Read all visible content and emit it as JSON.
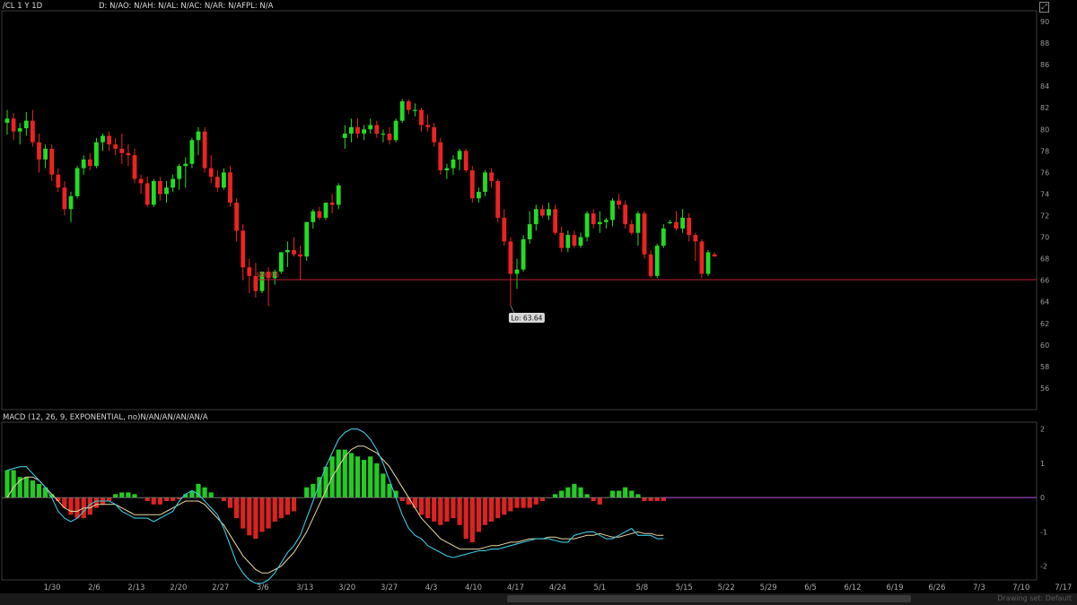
{
  "header": {
    "symbol_label": "/CL 1 Y 1D",
    "ohlc_label": "D: N/AO: N/AH: N/AL: N/AC: N/AR: N/AFPL: N/A"
  },
  "macd_header": {
    "label": "MACD (12, 26, 9, EXPONENTIAL, no)N/AN/AN/AN/AN/A"
  },
  "toolbar": {
    "drawing_set_label": "Drawing set: Default"
  },
  "colors": {
    "up": "#22dd22",
    "down": "#ee2222",
    "support_line": "#c0203a",
    "macd": "#3cc8e0",
    "signal": "#e8d8a0",
    "hist_up": "#22cc22",
    "hist_down": "#dd2222",
    "zero_line": "#aa44cc"
  },
  "chart_data": [
    {
      "type": "candlestick",
      "title": "/CL 1 Y 1D",
      "ylim": [
        54,
        91
      ],
      "y_ticks": [
        56,
        58,
        60,
        62,
        64,
        66,
        68,
        70,
        72,
        74,
        76,
        78,
        80,
        82,
        84,
        86,
        88,
        90
      ],
      "x_ticks": [
        "1/30",
        "2/6",
        "2/13",
        "2/20",
        "2/27",
        "3/6",
        "3/13",
        "3/20",
        "3/27",
        "4/3",
        "4/10",
        "4/17",
        "4/24",
        "5/1",
        "5/8",
        "5/15",
        "5/22",
        "5/29",
        "6/5",
        "6/12",
        "6/19",
        "6/26",
        "7/3",
        "7/10",
        "7/17"
      ],
      "support_level": {
        "value": 66.06,
        "label": "$66.06"
      },
      "low_annotation": {
        "value": 63.64,
        "label": "Lo: 63.64"
      },
      "candles": [
        {
          "o": 80.6,
          "h": 81.8,
          "l": 79.5,
          "c": 81.0
        },
        {
          "o": 81.0,
          "h": 81.5,
          "l": 79.0,
          "c": 79.8
        },
        {
          "o": 79.8,
          "h": 80.6,
          "l": 78.6,
          "c": 80.1
        },
        {
          "o": 80.1,
          "h": 81.6,
          "l": 79.4,
          "c": 80.8
        },
        {
          "o": 80.8,
          "h": 81.8,
          "l": 78.4,
          "c": 78.8
        },
        {
          "o": 78.8,
          "h": 79.6,
          "l": 76.0,
          "c": 77.2
        },
        {
          "o": 77.2,
          "h": 78.6,
          "l": 76.4,
          "c": 78.2
        },
        {
          "o": 78.2,
          "h": 78.6,
          "l": 75.2,
          "c": 75.8
        },
        {
          "o": 75.8,
          "h": 76.4,
          "l": 74.2,
          "c": 74.6
        },
        {
          "o": 74.6,
          "h": 75.2,
          "l": 72.0,
          "c": 72.6
        },
        {
          "o": 72.6,
          "h": 74.2,
          "l": 71.4,
          "c": 73.8
        },
        {
          "o": 73.8,
          "h": 76.6,
          "l": 73.6,
          "c": 76.4
        },
        {
          "o": 76.4,
          "h": 77.6,
          "l": 75.8,
          "c": 77.2
        },
        {
          "o": 77.2,
          "h": 77.8,
          "l": 76.2,
          "c": 76.6
        },
        {
          "o": 76.6,
          "h": 79.2,
          "l": 76.4,
          "c": 78.8
        },
        {
          "o": 78.8,
          "h": 79.6,
          "l": 78.0,
          "c": 79.4
        },
        {
          "o": 79.4,
          "h": 79.8,
          "l": 78.0,
          "c": 78.6
        },
        {
          "o": 78.6,
          "h": 79.2,
          "l": 77.6,
          "c": 78.2
        },
        {
          "o": 78.2,
          "h": 79.6,
          "l": 76.8,
          "c": 77.8
        },
        {
          "o": 77.8,
          "h": 78.6,
          "l": 76.6,
          "c": 77.6
        },
        {
          "o": 77.6,
          "h": 78.2,
          "l": 75.0,
          "c": 75.4
        },
        {
          "o": 75.4,
          "h": 75.8,
          "l": 74.0,
          "c": 75.0
        },
        {
          "o": 75.0,
          "h": 75.6,
          "l": 72.8,
          "c": 73.0
        },
        {
          "o": 73.0,
          "h": 75.4,
          "l": 72.8,
          "c": 75.2
        },
        {
          "o": 75.2,
          "h": 75.6,
          "l": 73.4,
          "c": 74.0
        },
        {
          "o": 74.0,
          "h": 75.2,
          "l": 73.2,
          "c": 74.6
        },
        {
          "o": 74.6,
          "h": 75.8,
          "l": 74.2,
          "c": 75.4
        },
        {
          "o": 75.4,
          "h": 76.8,
          "l": 74.4,
          "c": 76.6
        },
        {
          "o": 76.6,
          "h": 77.4,
          "l": 74.6,
          "c": 76.8
        },
        {
          "o": 76.8,
          "h": 79.2,
          "l": 76.4,
          "c": 79.0
        },
        {
          "o": 79.0,
          "h": 80.2,
          "l": 77.6,
          "c": 79.8
        },
        {
          "o": 79.8,
          "h": 80.2,
          "l": 76.0,
          "c": 76.4
        },
        {
          "o": 76.4,
          "h": 77.6,
          "l": 75.0,
          "c": 75.6
        },
        {
          "o": 75.6,
          "h": 76.2,
          "l": 74.2,
          "c": 74.6
        },
        {
          "o": 74.6,
          "h": 76.4,
          "l": 74.4,
          "c": 76.0
        },
        {
          "o": 76.0,
          "h": 76.6,
          "l": 72.8,
          "c": 73.2
        },
        {
          "o": 73.2,
          "h": 73.6,
          "l": 69.6,
          "c": 70.6
        },
        {
          "o": 70.6,
          "h": 71.2,
          "l": 66.0,
          "c": 67.2
        },
        {
          "o": 67.2,
          "h": 68.0,
          "l": 64.8,
          "c": 66.4
        },
        {
          "o": 66.4,
          "h": 67.6,
          "l": 64.4,
          "c": 65.0
        },
        {
          "o": 65.0,
          "h": 66.4,
          "l": 64.8,
          "c": 66.8
        },
        {
          "o": 66.8,
          "h": 67.2,
          "l": 63.6,
          "c": 66.2
        },
        {
          "o": 66.2,
          "h": 67.0,
          "l": 65.6,
          "c": 66.8
        },
        {
          "o": 66.8,
          "h": 68.4,
          "l": 66.6,
          "c": 68.6
        },
        {
          "o": 68.6,
          "h": 69.6,
          "l": 67.2,
          "c": 68.8
        },
        {
          "o": 68.8,
          "h": 70.0,
          "l": 68.2,
          "c": 68.4
        },
        {
          "o": 68.4,
          "h": 69.2,
          "l": 66.0,
          "c": 68.2
        },
        {
          "o": 68.2,
          "h": 71.4,
          "l": 67.8,
          "c": 71.4
        },
        {
          "o": 71.4,
          "h": 72.6,
          "l": 70.8,
          "c": 72.4
        },
        {
          "o": 72.4,
          "h": 72.8,
          "l": 71.6,
          "c": 71.8
        },
        {
          "o": 71.8,
          "h": 73.0,
          "l": 71.6,
          "c": 73.2
        },
        {
          "o": 73.2,
          "h": 74.0,
          "l": 72.2,
          "c": 73.0
        },
        {
          "o": 73.0,
          "h": 75.0,
          "l": 72.6,
          "c": 74.8
        },
        {
          "o": 79.2,
          "h": 80.4,
          "l": 78.2,
          "c": 79.6
        },
        {
          "o": 79.6,
          "h": 81.0,
          "l": 78.8,
          "c": 80.2
        },
        {
          "o": 80.2,
          "h": 81.0,
          "l": 79.2,
          "c": 79.6
        },
        {
          "o": 79.6,
          "h": 80.4,
          "l": 79.0,
          "c": 80.0
        },
        {
          "o": 80.0,
          "h": 81.0,
          "l": 79.6,
          "c": 80.4
        },
        {
          "o": 80.4,
          "h": 80.8,
          "l": 79.2,
          "c": 79.6
        },
        {
          "o": 79.6,
          "h": 80.0,
          "l": 78.8,
          "c": 79.6
        },
        {
          "o": 79.6,
          "h": 80.2,
          "l": 78.6,
          "c": 79.0
        },
        {
          "o": 79.0,
          "h": 81.0,
          "l": 78.8,
          "c": 80.8
        },
        {
          "o": 80.8,
          "h": 82.8,
          "l": 80.6,
          "c": 82.6
        },
        {
          "o": 82.6,
          "h": 82.8,
          "l": 81.4,
          "c": 81.8
        },
        {
          "o": 81.8,
          "h": 82.4,
          "l": 81.2,
          "c": 81.8
        },
        {
          "o": 81.8,
          "h": 82.0,
          "l": 79.8,
          "c": 80.4
        },
        {
          "o": 80.4,
          "h": 81.4,
          "l": 79.8,
          "c": 80.2
        },
        {
          "o": 80.2,
          "h": 80.6,
          "l": 78.4,
          "c": 78.8
        },
        {
          "o": 78.8,
          "h": 79.2,
          "l": 75.8,
          "c": 76.2
        },
        {
          "o": 76.2,
          "h": 76.8,
          "l": 75.4,
          "c": 76.4
        },
        {
          "o": 76.4,
          "h": 77.6,
          "l": 75.8,
          "c": 77.2
        },
        {
          "o": 77.2,
          "h": 78.2,
          "l": 76.2,
          "c": 78.0
        },
        {
          "o": 78.0,
          "h": 78.2,
          "l": 76.0,
          "c": 76.2
        },
        {
          "o": 76.2,
          "h": 76.6,
          "l": 73.2,
          "c": 73.6
        },
        {
          "o": 73.6,
          "h": 74.6,
          "l": 73.2,
          "c": 74.2
        },
        {
          "o": 74.2,
          "h": 76.2,
          "l": 73.8,
          "c": 76.0
        },
        {
          "o": 76.0,
          "h": 76.4,
          "l": 74.6,
          "c": 75.2
        },
        {
          "o": 75.2,
          "h": 75.4,
          "l": 71.4,
          "c": 71.8
        },
        {
          "o": 71.8,
          "h": 72.6,
          "l": 69.2,
          "c": 69.6
        },
        {
          "o": 69.6,
          "h": 70.0,
          "l": 63.64,
          "c": 66.6
        },
        {
          "o": 66.6,
          "h": 68.0,
          "l": 65.2,
          "c": 67.0
        },
        {
          "o": 67.0,
          "h": 70.2,
          "l": 66.8,
          "c": 69.8
        },
        {
          "o": 69.8,
          "h": 72.4,
          "l": 69.4,
          "c": 71.2
        },
        {
          "o": 71.2,
          "h": 73.0,
          "l": 70.6,
          "c": 72.6
        },
        {
          "o": 72.6,
          "h": 73.0,
          "l": 71.8,
          "c": 72.0
        },
        {
          "o": 72.0,
          "h": 73.2,
          "l": 71.6,
          "c": 72.6
        },
        {
          "o": 72.6,
          "h": 73.0,
          "l": 70.2,
          "c": 70.4
        },
        {
          "o": 70.4,
          "h": 71.0,
          "l": 68.6,
          "c": 69.0
        },
        {
          "o": 69.0,
          "h": 70.6,
          "l": 68.6,
          "c": 70.2
        },
        {
          "o": 70.2,
          "h": 70.6,
          "l": 69.0,
          "c": 69.2
        },
        {
          "o": 69.2,
          "h": 70.4,
          "l": 69.0,
          "c": 70.0
        },
        {
          "o": 70.0,
          "h": 72.4,
          "l": 69.6,
          "c": 72.2
        },
        {
          "o": 72.2,
          "h": 72.6,
          "l": 70.8,
          "c": 71.2
        },
        {
          "o": 71.2,
          "h": 72.4,
          "l": 70.4,
          "c": 71.4
        },
        {
          "o": 71.4,
          "h": 71.8,
          "l": 70.8,
          "c": 71.6
        },
        {
          "o": 71.6,
          "h": 73.6,
          "l": 71.0,
          "c": 73.4
        },
        {
          "o": 73.4,
          "h": 74.0,
          "l": 72.6,
          "c": 73.0
        },
        {
          "o": 73.0,
          "h": 73.4,
          "l": 70.8,
          "c": 71.2
        },
        {
          "o": 71.2,
          "h": 71.6,
          "l": 70.2,
          "c": 70.4
        },
        {
          "o": 70.4,
          "h": 72.4,
          "l": 69.2,
          "c": 72.2
        },
        {
          "o": 72.2,
          "h": 72.4,
          "l": 68.0,
          "c": 68.4
        },
        {
          "o": 68.4,
          "h": 68.8,
          "l": 66.2,
          "c": 66.4
        },
        {
          "o": 66.4,
          "h": 69.4,
          "l": 66.2,
          "c": 69.2
        },
        {
          "o": 69.2,
          "h": 71.2,
          "l": 69.0,
          "c": 70.8
        },
        {
          "o": 71.4,
          "h": 71.6,
          "l": 71.2,
          "c": 71.4
        },
        {
          "o": 71.4,
          "h": 72.4,
          "l": 70.6,
          "c": 70.8
        },
        {
          "o": 70.8,
          "h": 72.6,
          "l": 70.4,
          "c": 71.8
        },
        {
          "o": 71.8,
          "h": 72.2,
          "l": 69.6,
          "c": 70.2
        },
        {
          "o": 70.2,
          "h": 70.4,
          "l": 67.8,
          "c": 69.6
        },
        {
          "o": 69.6,
          "h": 69.8,
          "l": 66.2,
          "c": 66.6
        },
        {
          "o": 66.6,
          "h": 68.8,
          "l": 66.4,
          "c": 68.6
        },
        {
          "o": 68.4,
          "h": 68.6,
          "l": 68.2,
          "c": 68.2
        }
      ]
    },
    {
      "type": "bar+line",
      "title": "MACD (12, 26, 9, EXPONENTIAL, no)",
      "ylim": [
        -2.4,
        2.2
      ],
      "y_ticks": [
        -2,
        -1,
        0,
        1,
        2
      ],
      "histogram": [
        0.8,
        0.8,
        0.6,
        0.6,
        0.5,
        0.4,
        0.3,
        0.1,
        -0.1,
        -0.3,
        -0.5,
        -0.6,
        -0.6,
        -0.5,
        -0.3,
        -0.2,
        -0.1,
        0.1,
        0.15,
        0.15,
        0.1,
        0.0,
        -0.1,
        -0.2,
        -0.2,
        -0.1,
        -0.1,
        -0.05,
        0.1,
        0.2,
        0.4,
        0.3,
        0.15,
        0.0,
        -0.1,
        -0.3,
        -0.6,
        -0.9,
        -1.1,
        -1.2,
        -1.0,
        -0.9,
        -0.7,
        -0.6,
        -0.5,
        -0.4,
        0.0,
        0.3,
        0.4,
        0.6,
        0.9,
        1.2,
        1.4,
        1.4,
        1.3,
        1.2,
        1.1,
        1.2,
        1.0,
        0.7,
        0.4,
        0.2,
        -0.1,
        -0.2,
        -0.3,
        -0.5,
        -0.6,
        -0.7,
        -0.8,
        -0.7,
        -0.6,
        -0.8,
        -1.2,
        -1.3,
        -1.0,
        -0.8,
        -0.7,
        -0.6,
        -0.5,
        -0.4,
        -0.3,
        -0.3,
        -0.3,
        -0.2,
        -0.1,
        0.0,
        0.1,
        0.2,
        0.3,
        0.4,
        0.3,
        0.1,
        -0.1,
        -0.2,
        0.0,
        0.2,
        0.2,
        0.3,
        0.2,
        0.1,
        -0.1,
        -0.1,
        -0.1,
        -0.1
      ],
      "macd": [
        0.8,
        0.85,
        0.9,
        0.9,
        0.7,
        0.5,
        0.3,
        0.0,
        -0.4,
        -0.6,
        -0.7,
        -0.6,
        -0.4,
        -0.2,
        -0.1,
        -0.1,
        -0.1,
        -0.2,
        -0.4,
        -0.5,
        -0.6,
        -0.6,
        -0.6,
        -0.7,
        -0.6,
        -0.5,
        -0.4,
        -0.1,
        0.1,
        0.2,
        0.1,
        -0.1,
        -0.3,
        -0.5,
        -0.9,
        -1.4,
        -1.9,
        -2.2,
        -2.4,
        -2.5,
        -2.5,
        -2.4,
        -2.2,
        -1.9,
        -1.6,
        -1.4,
        -1.1,
        -0.6,
        -0.1,
        0.4,
        0.9,
        1.3,
        1.7,
        1.9,
        2.0,
        2.0,
        1.9,
        1.7,
        1.4,
        1.0,
        0.5,
        0.0,
        -0.5,
        -0.9,
        -1.1,
        -1.2,
        -1.4,
        -1.5,
        -1.6,
        -1.7,
        -1.75,
        -1.7,
        -1.65,
        -1.6,
        -1.55,
        -1.55,
        -1.5,
        -1.5,
        -1.45,
        -1.4,
        -1.35,
        -1.3,
        -1.25,
        -1.2,
        -1.2,
        -1.2,
        -1.25,
        -1.3,
        -1.3,
        -1.1,
        -1.05,
        -1.0,
        -1.0,
        -1.1,
        -1.2,
        -1.2,
        -1.1,
        -1.0,
        -0.9,
        -1.1,
        -1.1,
        -1.1,
        -1.2,
        -1.2
      ],
      "signal": [
        0.0,
        0.3,
        0.5,
        0.6,
        0.6,
        0.5,
        0.3,
        0.1,
        -0.1,
        -0.3,
        -0.4,
        -0.4,
        -0.3,
        -0.3,
        -0.2,
        -0.2,
        -0.2,
        -0.2,
        -0.3,
        -0.4,
        -0.5,
        -0.5,
        -0.5,
        -0.5,
        -0.5,
        -0.4,
        -0.3,
        -0.2,
        -0.1,
        -0.1,
        -0.1,
        -0.2,
        -0.4,
        -0.6,
        -0.8,
        -1.1,
        -1.4,
        -1.7,
        -1.9,
        -2.1,
        -2.2,
        -2.2,
        -2.1,
        -2.0,
        -1.8,
        -1.6,
        -1.3,
        -1.0,
        -0.6,
        -0.2,
        0.2,
        0.6,
        0.9,
        1.2,
        1.4,
        1.5,
        1.5,
        1.4,
        1.3,
        1.1,
        0.9,
        0.6,
        0.3,
        0.0,
        -0.3,
        -0.6,
        -0.8,
        -1.0,
        -1.2,
        -1.3,
        -1.4,
        -1.5,
        -1.5,
        -1.5,
        -1.5,
        -1.45,
        -1.4,
        -1.4,
        -1.35,
        -1.3,
        -1.3,
        -1.25,
        -1.2,
        -1.2,
        -1.2,
        -1.15,
        -1.15,
        -1.2,
        -1.2,
        -1.2,
        -1.15,
        -1.1,
        -1.1,
        -1.05,
        -1.1,
        -1.15,
        -1.15,
        -1.1,
        -1.05,
        -1.0,
        -1.05,
        -1.05,
        -1.1,
        -1.1
      ]
    }
  ]
}
